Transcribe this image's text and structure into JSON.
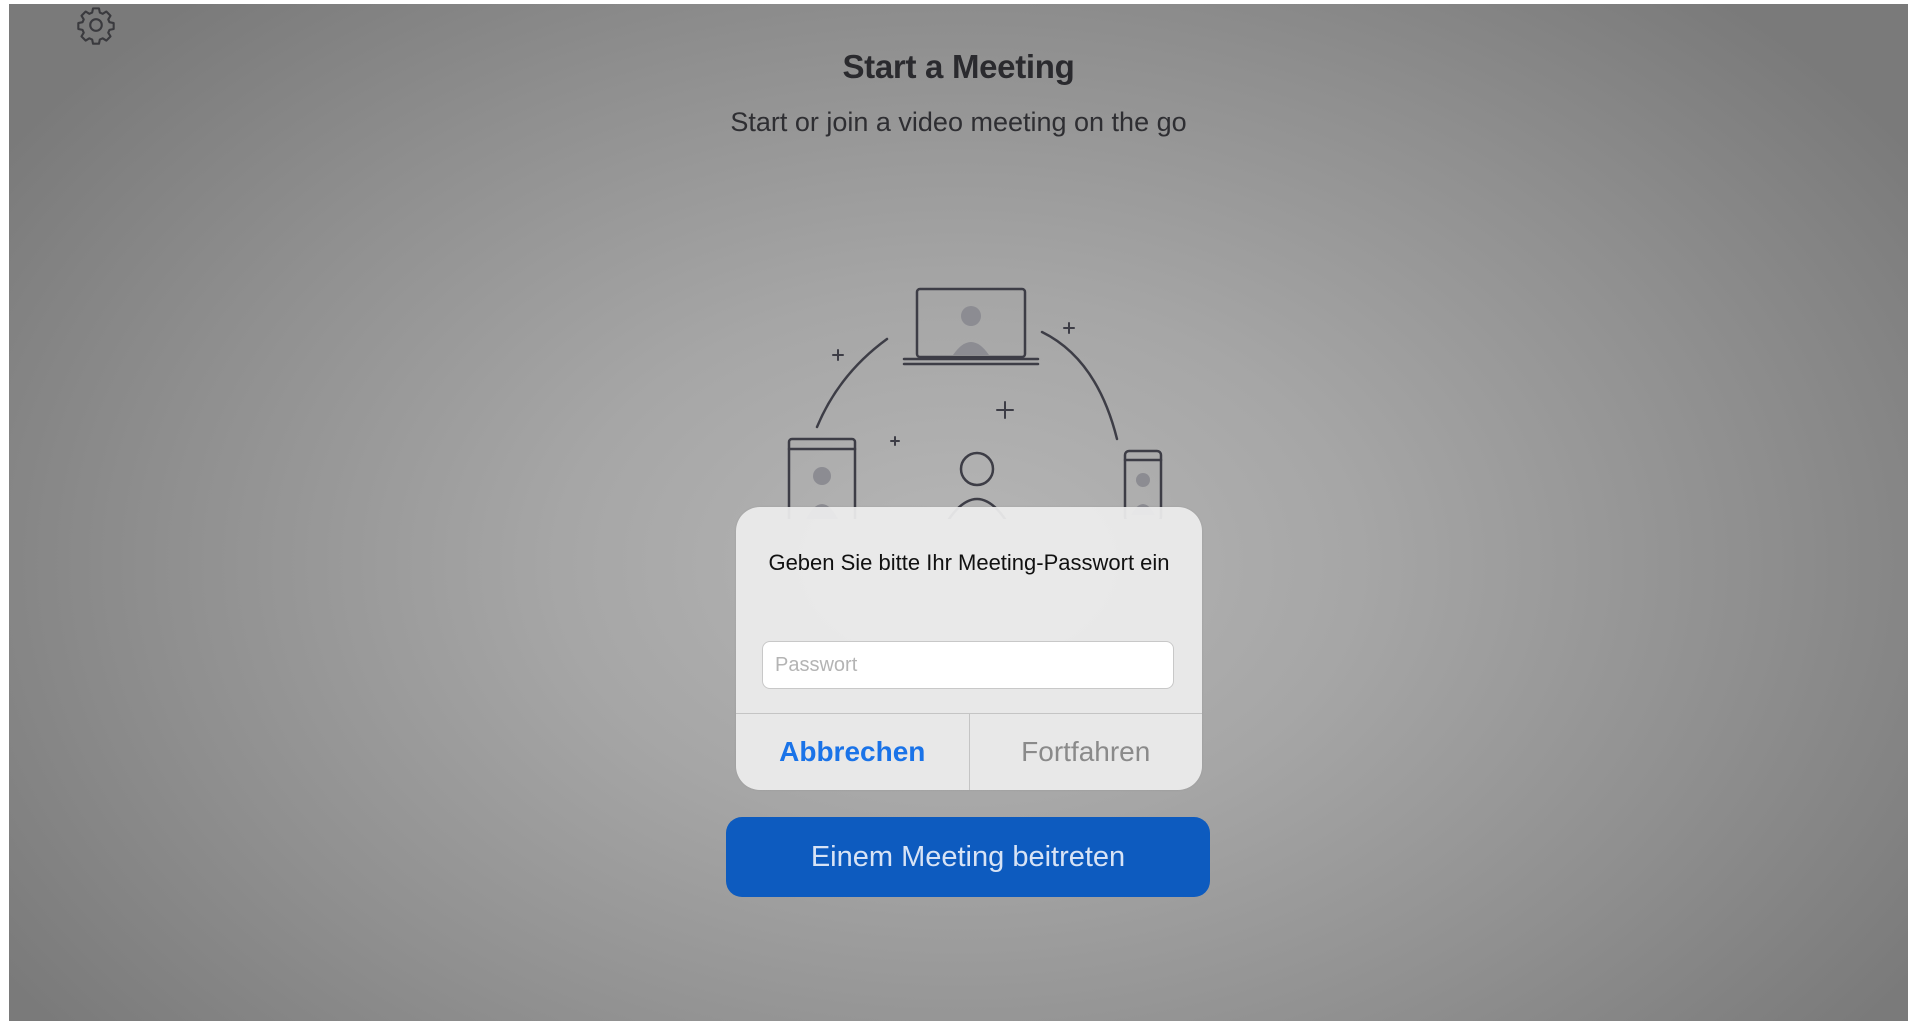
{
  "header": {
    "settings_icon": "gear-icon",
    "title": "Start a Meeting",
    "subtitle": "Start or join a video meeting on the go"
  },
  "illustration": {
    "icons": [
      "laptop-icon",
      "tablet-icon",
      "person-icon",
      "phone-icon",
      "plus-icon"
    ]
  },
  "dialog": {
    "title": "Geben Sie bitte Ihr Meeting-Passwort ein",
    "password_placeholder": "Passwort",
    "password_value": "",
    "cancel_label": "Abbrechen",
    "continue_label": "Fortfahren"
  },
  "join_button": {
    "label": "Einem Meeting beitreten"
  },
  "colors": {
    "accent_blue": "#0d5bbf",
    "link_blue": "#1a73e8",
    "disabled_gray": "#8a8a8a"
  }
}
